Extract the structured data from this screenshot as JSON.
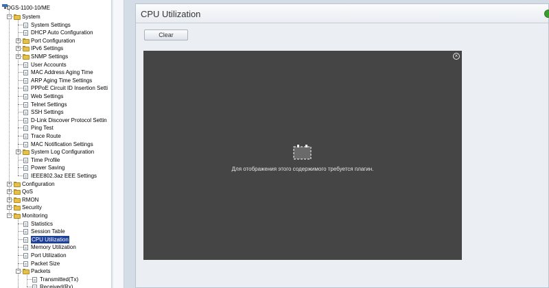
{
  "tree": {
    "root": "DGS-1100-10/ME",
    "items": [
      {
        "label": "System"
      },
      {
        "label": "System Settings"
      },
      {
        "label": "DHCP Auto Configuration"
      },
      {
        "label": "Port Configuration"
      },
      {
        "label": "IPv6 Settings"
      },
      {
        "label": "SNMP Settings"
      },
      {
        "label": "User Accounts"
      },
      {
        "label": "MAC Address Aging Time"
      },
      {
        "label": "ARP Aging Time Settings"
      },
      {
        "label": "PPPoE Circuit ID Insertion Setti"
      },
      {
        "label": "Web Settings"
      },
      {
        "label": "Telnet Settings"
      },
      {
        "label": "SSH Settings"
      },
      {
        "label": "D-Link Discover Protocol Settin"
      },
      {
        "label": "Ping Test"
      },
      {
        "label": "Trace Route"
      },
      {
        "label": "MAC Notification Settings"
      },
      {
        "label": "System Log Configuration"
      },
      {
        "label": "Time Profile"
      },
      {
        "label": "Power Saving"
      },
      {
        "label": "IEEE802.3az EEE Settings"
      },
      {
        "label": "Configuration"
      },
      {
        "label": "QoS"
      },
      {
        "label": "RMON"
      },
      {
        "label": "Security"
      },
      {
        "label": "Monitoring"
      },
      {
        "label": "Statistics"
      },
      {
        "label": "Session Table"
      },
      {
        "label": "CPU Utilization"
      },
      {
        "label": "Memory Utilization"
      },
      {
        "label": "Port Utilization"
      },
      {
        "label": "Packet Size"
      },
      {
        "label": "Packets"
      },
      {
        "label": "Transmitted(Tx)"
      },
      {
        "label": "Received(Rx)"
      }
    ],
    "expander_plus": "+",
    "expander_minus": "−"
  },
  "page": {
    "title": "CPU Utilization",
    "clear_label": "Clear",
    "plugin_message": "Для отображения этого содержимого требуется плагин.",
    "close_glyph": "×"
  },
  "colors": {
    "selected_bg": "#1c3f9a",
    "plugin_bg": "#454545",
    "folder": "#e6c04a",
    "refresh": "#3a9c2e"
  }
}
